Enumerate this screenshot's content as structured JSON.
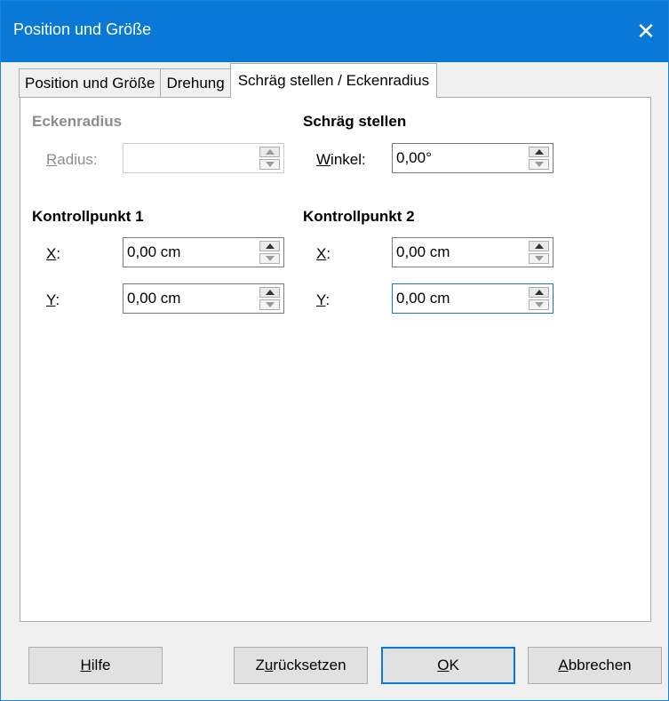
{
  "window": {
    "title": "Position und Größe",
    "close_glyph": "✕"
  },
  "tabs": [
    {
      "label": "Position und Größe"
    },
    {
      "label": "Drehung"
    },
    {
      "label": "Schräg stellen / Eckenradius"
    }
  ],
  "corner_radius": {
    "heading": "Eckenradius",
    "radius_label_accel": "R",
    "radius_label_rest": "adius:",
    "radius_value": ""
  },
  "slant": {
    "heading": "Schräg stellen",
    "angle_label_accel": "W",
    "angle_label_rest": "inkel:",
    "angle_value": "0,00°"
  },
  "control_point_1": {
    "heading": "Kontrollpunkt 1",
    "x_label_accel": "X",
    "x_label_rest": ":",
    "x_value": "0,00 cm",
    "y_label_accel": "Y",
    "y_label_rest": ":",
    "y_value": "0,00 cm"
  },
  "control_point_2": {
    "heading": "Kontrollpunkt 2",
    "x_label_accel": "X",
    "x_label_rest": ":",
    "x_value": "0,00 cm",
    "y_label_accel": "Y",
    "y_label_rest": ":",
    "y_value": "0,00 cm"
  },
  "buttons": {
    "help_accel": "H",
    "help_rest": "ilfe",
    "reset_pre": "Z",
    "reset_accel": "u",
    "reset_rest": "rücksetzen",
    "ok_accel": "O",
    "ok_rest": "K",
    "cancel_accel": "A",
    "cancel_rest": "bbrechen"
  },
  "colors": {
    "title_bar": "#0a78d7",
    "focus": "#0a78d7"
  }
}
